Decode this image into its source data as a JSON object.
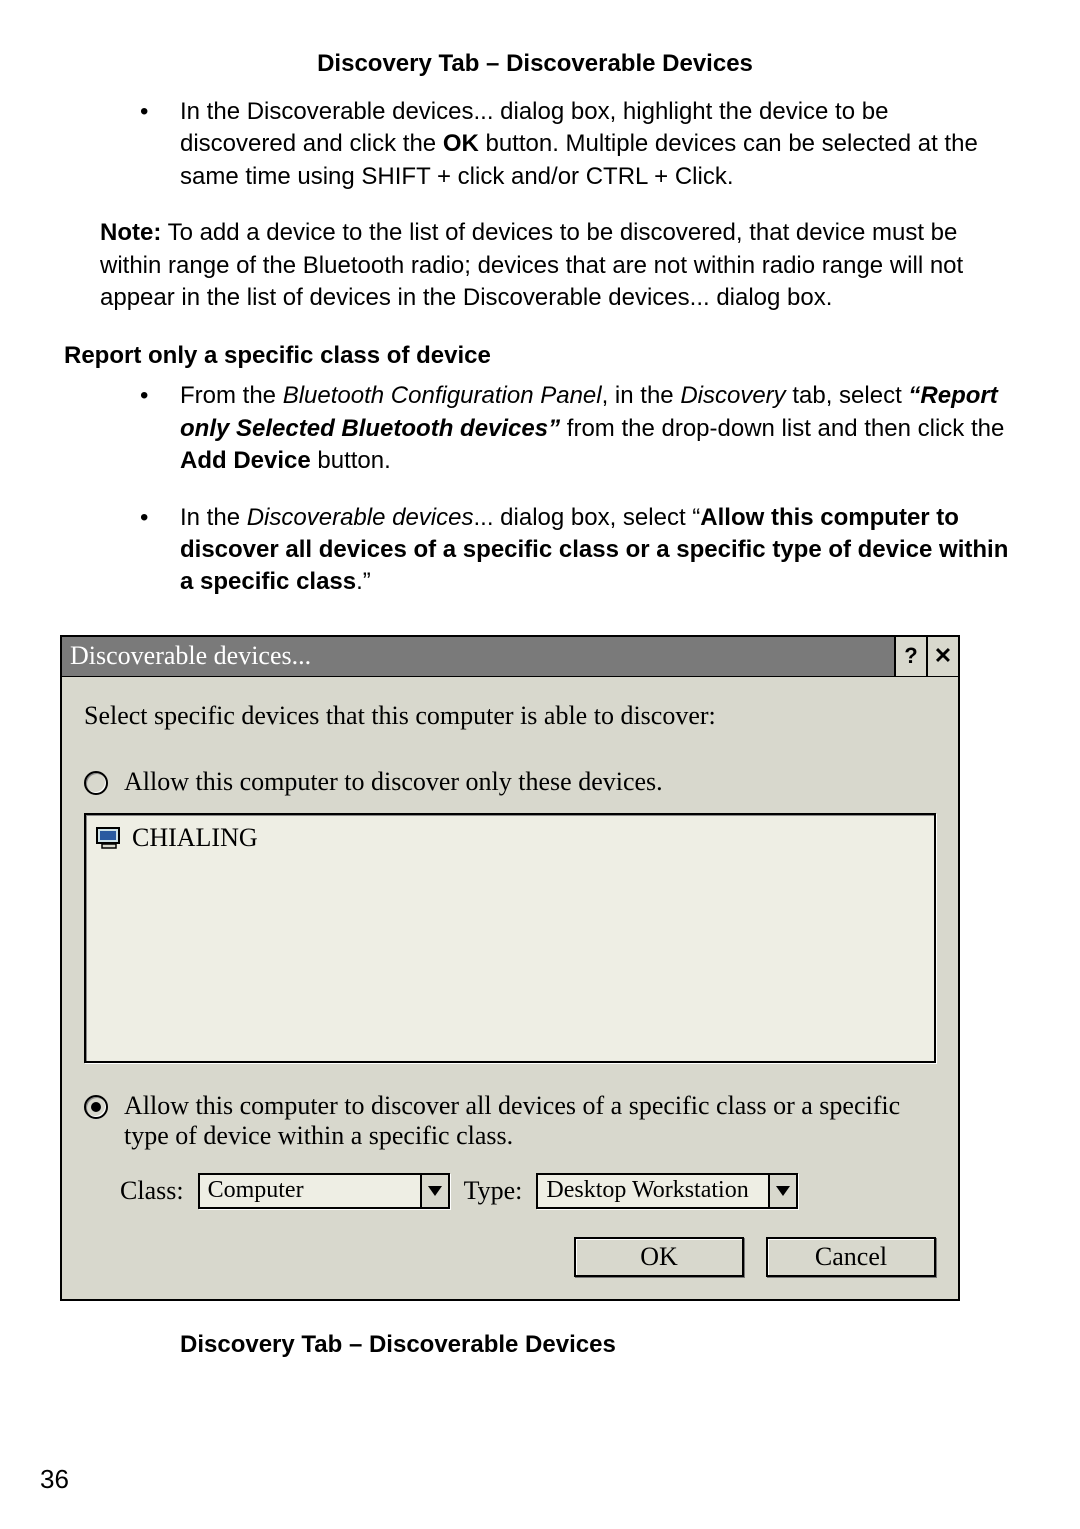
{
  "captions": {
    "top": "Discovery Tab – Discoverable Devices",
    "bottom": "Discovery Tab – Discoverable Devices"
  },
  "intro_bullet": {
    "pre": "In the Discoverable devices... dialog box, highlight the device to be discovered and click the ",
    "ok": "OK",
    "post": " button. Multiple devices can be selected at the same time using SHIFT + click and/or CTRL + Click."
  },
  "note": {
    "label": "Note:",
    "text": " To add a device to the list of devices to be discovered, that device must be within range of the Bluetooth radio; devices that are not within radio range will not appear in the list of devices in the Discoverable devices... dialog box."
  },
  "section_head": "Report only a specific class of device",
  "step1": {
    "a": "From the ",
    "b": "Bluetooth Configuration Panel",
    "c": ", in the ",
    "d": "Discovery",
    "e": " tab, select ",
    "f": "“Report only Selected Bluetooth devices”",
    "g": " from the drop-down list and then click the ",
    "h": "Add Device",
    "i": " button."
  },
  "step2": {
    "a": "In the ",
    "b": "Discoverable devices",
    "c": "... dialog box, select “",
    "d": "Allow this computer to discover all devices of a specific class or a specific type of device within a specific class",
    "e": ".”"
  },
  "dialog": {
    "title": "Discoverable devices...",
    "help": "?",
    "close": "✕",
    "prompt": "Select specific devices that this computer is able to discover:",
    "radio1": "Allow this computer to discover only these devices.",
    "device_name": "CHIALING",
    "radio2": "Allow this computer to discover all devices of a specific class or a specific type of device within a specific class.",
    "class_label": "Class:",
    "class_value": "Computer",
    "type_label": "Type:",
    "type_value": "Desktop Workstation",
    "ok": "OK",
    "cancel": "Cancel"
  },
  "page_number": "36"
}
